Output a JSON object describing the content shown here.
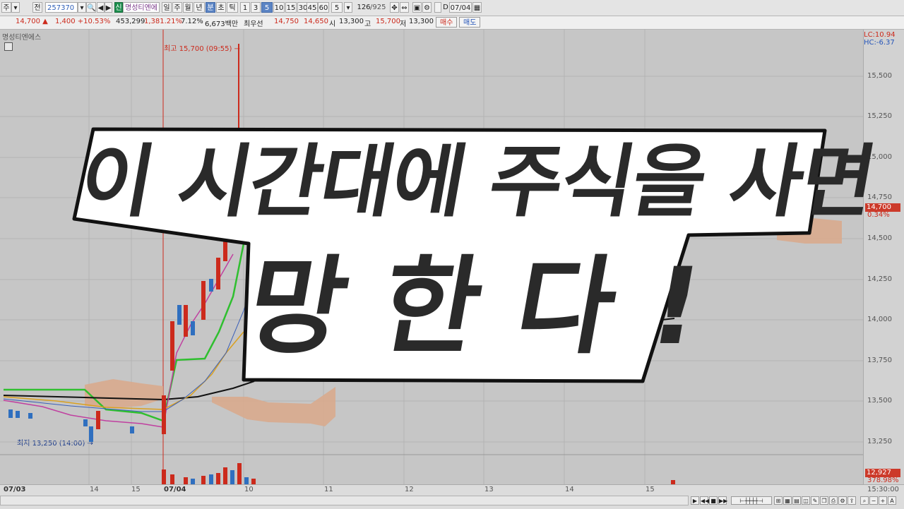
{
  "toolbar": {
    "items": [
      "주",
      "▾",
      "전",
      "257370",
      "▾",
      "🔍",
      "◀",
      "▶",
      "신",
      "명성티엔에",
      "일",
      "주",
      "월",
      "년",
      "분",
      "초",
      "틱",
      "1",
      "3",
      "5",
      "10",
      "15",
      "30",
      "45",
      "60",
      "5",
      "▾",
      "126",
      "/925",
      "D",
      "07/04"
    ],
    "code": "257370",
    "stock_name": "명성티엔에",
    "new_badge": "신",
    "periods": [
      "일",
      "주",
      "월",
      "년",
      "분",
      "초",
      "틱"
    ],
    "intervals": [
      "1",
      "3",
      "5",
      "10",
      "15",
      "30",
      "45",
      "60"
    ],
    "active_period": "분",
    "active_interval": "5",
    "count_value": "5",
    "page_current": "126",
    "page_total": "/925",
    "d_label": "D",
    "date_value": "07/04"
  },
  "quote": {
    "price": "14,700 ▲",
    "change": "1,400 +10.53%",
    "volume": "453,299",
    "vol_ratio": "1,381.21%",
    "turnover": "7.12%",
    "amount": "6,673백만",
    "best_label": "최우선",
    "best_ask": "14,750",
    "best_bid": "14,650",
    "open_label": "시",
    "open": "13,300",
    "high_label": "고",
    "high": "15,700",
    "low_label": "저",
    "low": "13,300",
    "buy_label": "매수",
    "sell_label": "매도"
  },
  "chart": {
    "title": "명성티엔에스",
    "lc": "LC:10.94",
    "hc": "HC:-6.37",
    "y_ticks": [
      "15,500",
      "15,250",
      "15,000",
      "14,750",
      "14,500",
      "14,250",
      "14,000",
      "13,750",
      "13,500",
      "13,250"
    ],
    "price_tag": "14,700",
    "price_pct": "0.34%",
    "vol_tag": "12,927",
    "vol_pct": "378.98%",
    "x_ticks": [
      "07/03",
      "14",
      "15",
      "07/04",
      "10",
      "11",
      "12",
      "13",
      "14",
      "15"
    ],
    "time_label": "15:30:00",
    "high_annotation": "최고 15,700 (09:55) →",
    "low_annotation": "최저 13,250 (14:00) →"
  },
  "overlay": {
    "line1": "이 시간대에 주식을 사면",
    "line2": "망 한 다 !"
  },
  "colors": {
    "up": "#cc2a1c",
    "down": "#2f6fbf",
    "cloud": "#d9a88a",
    "ma_green": "#2fbf2f",
    "caption_text": "#2a2a2a"
  }
}
